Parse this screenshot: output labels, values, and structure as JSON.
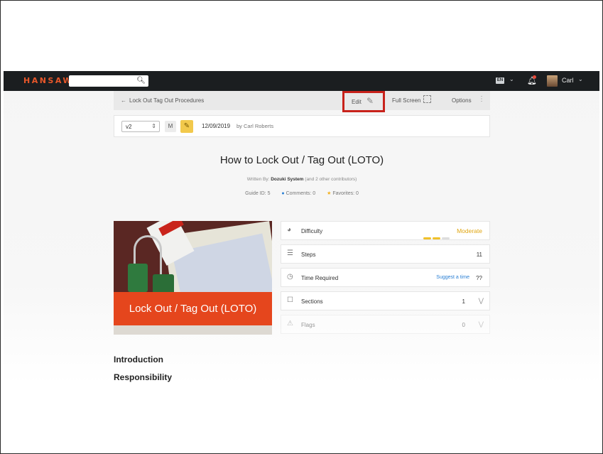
{
  "topbar": {
    "brand": "HANSAW",
    "search_placeholder": "",
    "language": "EN",
    "username": "Carl"
  },
  "guide_bar": {
    "back_label": "Lock Out Tag Out Procedures",
    "edit_label": "Edit",
    "fullscreen_label": "Full Screen",
    "options_label": "Options"
  },
  "version_bar": {
    "version": "v2",
    "m_label": "M",
    "date": "12/09/2019",
    "by": "by Carl Roberts"
  },
  "guide": {
    "title": "How to Lock Out / Tag Out (LOTO)",
    "written_prefix": "Written By:",
    "author": "Dozuki System",
    "contributors": "(and 2 other contributors)",
    "guide_id": "Guide ID: 5",
    "comments": "Comments: 0",
    "favorites": "Favorites: 0",
    "hero_text": "Lock Out / Tag Out (LOTO)"
  },
  "details": {
    "difficulty_label": "Difficulty",
    "difficulty_value": "Moderate",
    "difficulty_level": 2,
    "difficulty_max": 3,
    "steps_label": "Steps",
    "steps_value": "11",
    "time_label": "Time Required",
    "time_suggest": "Suggest a time",
    "time_value": "??",
    "sections_label": "Sections",
    "sections_value": "1",
    "flags_label": "Flags",
    "flags_value": "0"
  },
  "sections": {
    "intro": "Introduction",
    "responsibility": "Responsibility"
  },
  "colors": {
    "brand": "#e8572a",
    "highlight": "#c8221b",
    "difficulty": "#e0a612",
    "link": "#2a7fd4"
  }
}
